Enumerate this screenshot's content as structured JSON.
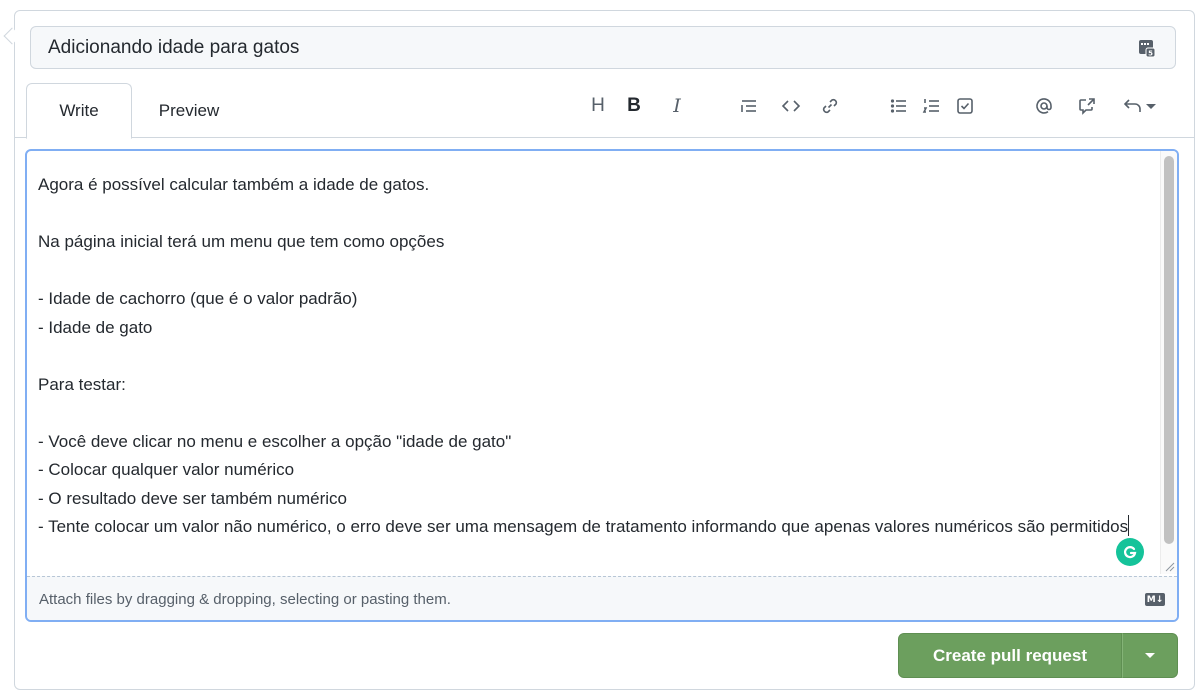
{
  "title_field": {
    "value": "Adicionando idade para gatos"
  },
  "tabs": [
    {
      "label": "Write",
      "active": true
    },
    {
      "label": "Preview",
      "active": false
    }
  ],
  "toolbar": {
    "icons": [
      "heading-icon",
      "bold-icon",
      "italic-icon",
      "quote-icon",
      "code-icon",
      "link-icon",
      "bulleted-list-icon",
      "numbered-list-icon",
      "task-list-icon",
      "mention-icon",
      "cross-reference-icon",
      "reply-icon"
    ],
    "heading": "H",
    "bold": "B",
    "italic": "I"
  },
  "editor": {
    "body": "Agora é possível calcular também a idade de gatos.\n\nNa página inicial terá um menu que tem como opções\n\n- Idade de cachorro (que é o valor padrão)\n- Idade de gato\n\nPara testar:\n\n- Você deve clicar no menu e escolher a opção \"idade de gato\"\n- Colocar qualquer valor numérico\n- O resultado deve ser também numérico\n- Tente colocar um valor não numérico, o erro deve ser uma mensagem de tratamento informando que apenas valores numéricos são permitidos",
    "footer_hint": "Attach files by dragging & dropping, selecting or pasting them.",
    "markdown_badge": "M↓"
  },
  "actions": {
    "create_label": "Create pull request"
  },
  "colors": {
    "primary_button": "#6c9f5e",
    "focus_border": "#80aef3",
    "grammarly": "#15c39a"
  }
}
